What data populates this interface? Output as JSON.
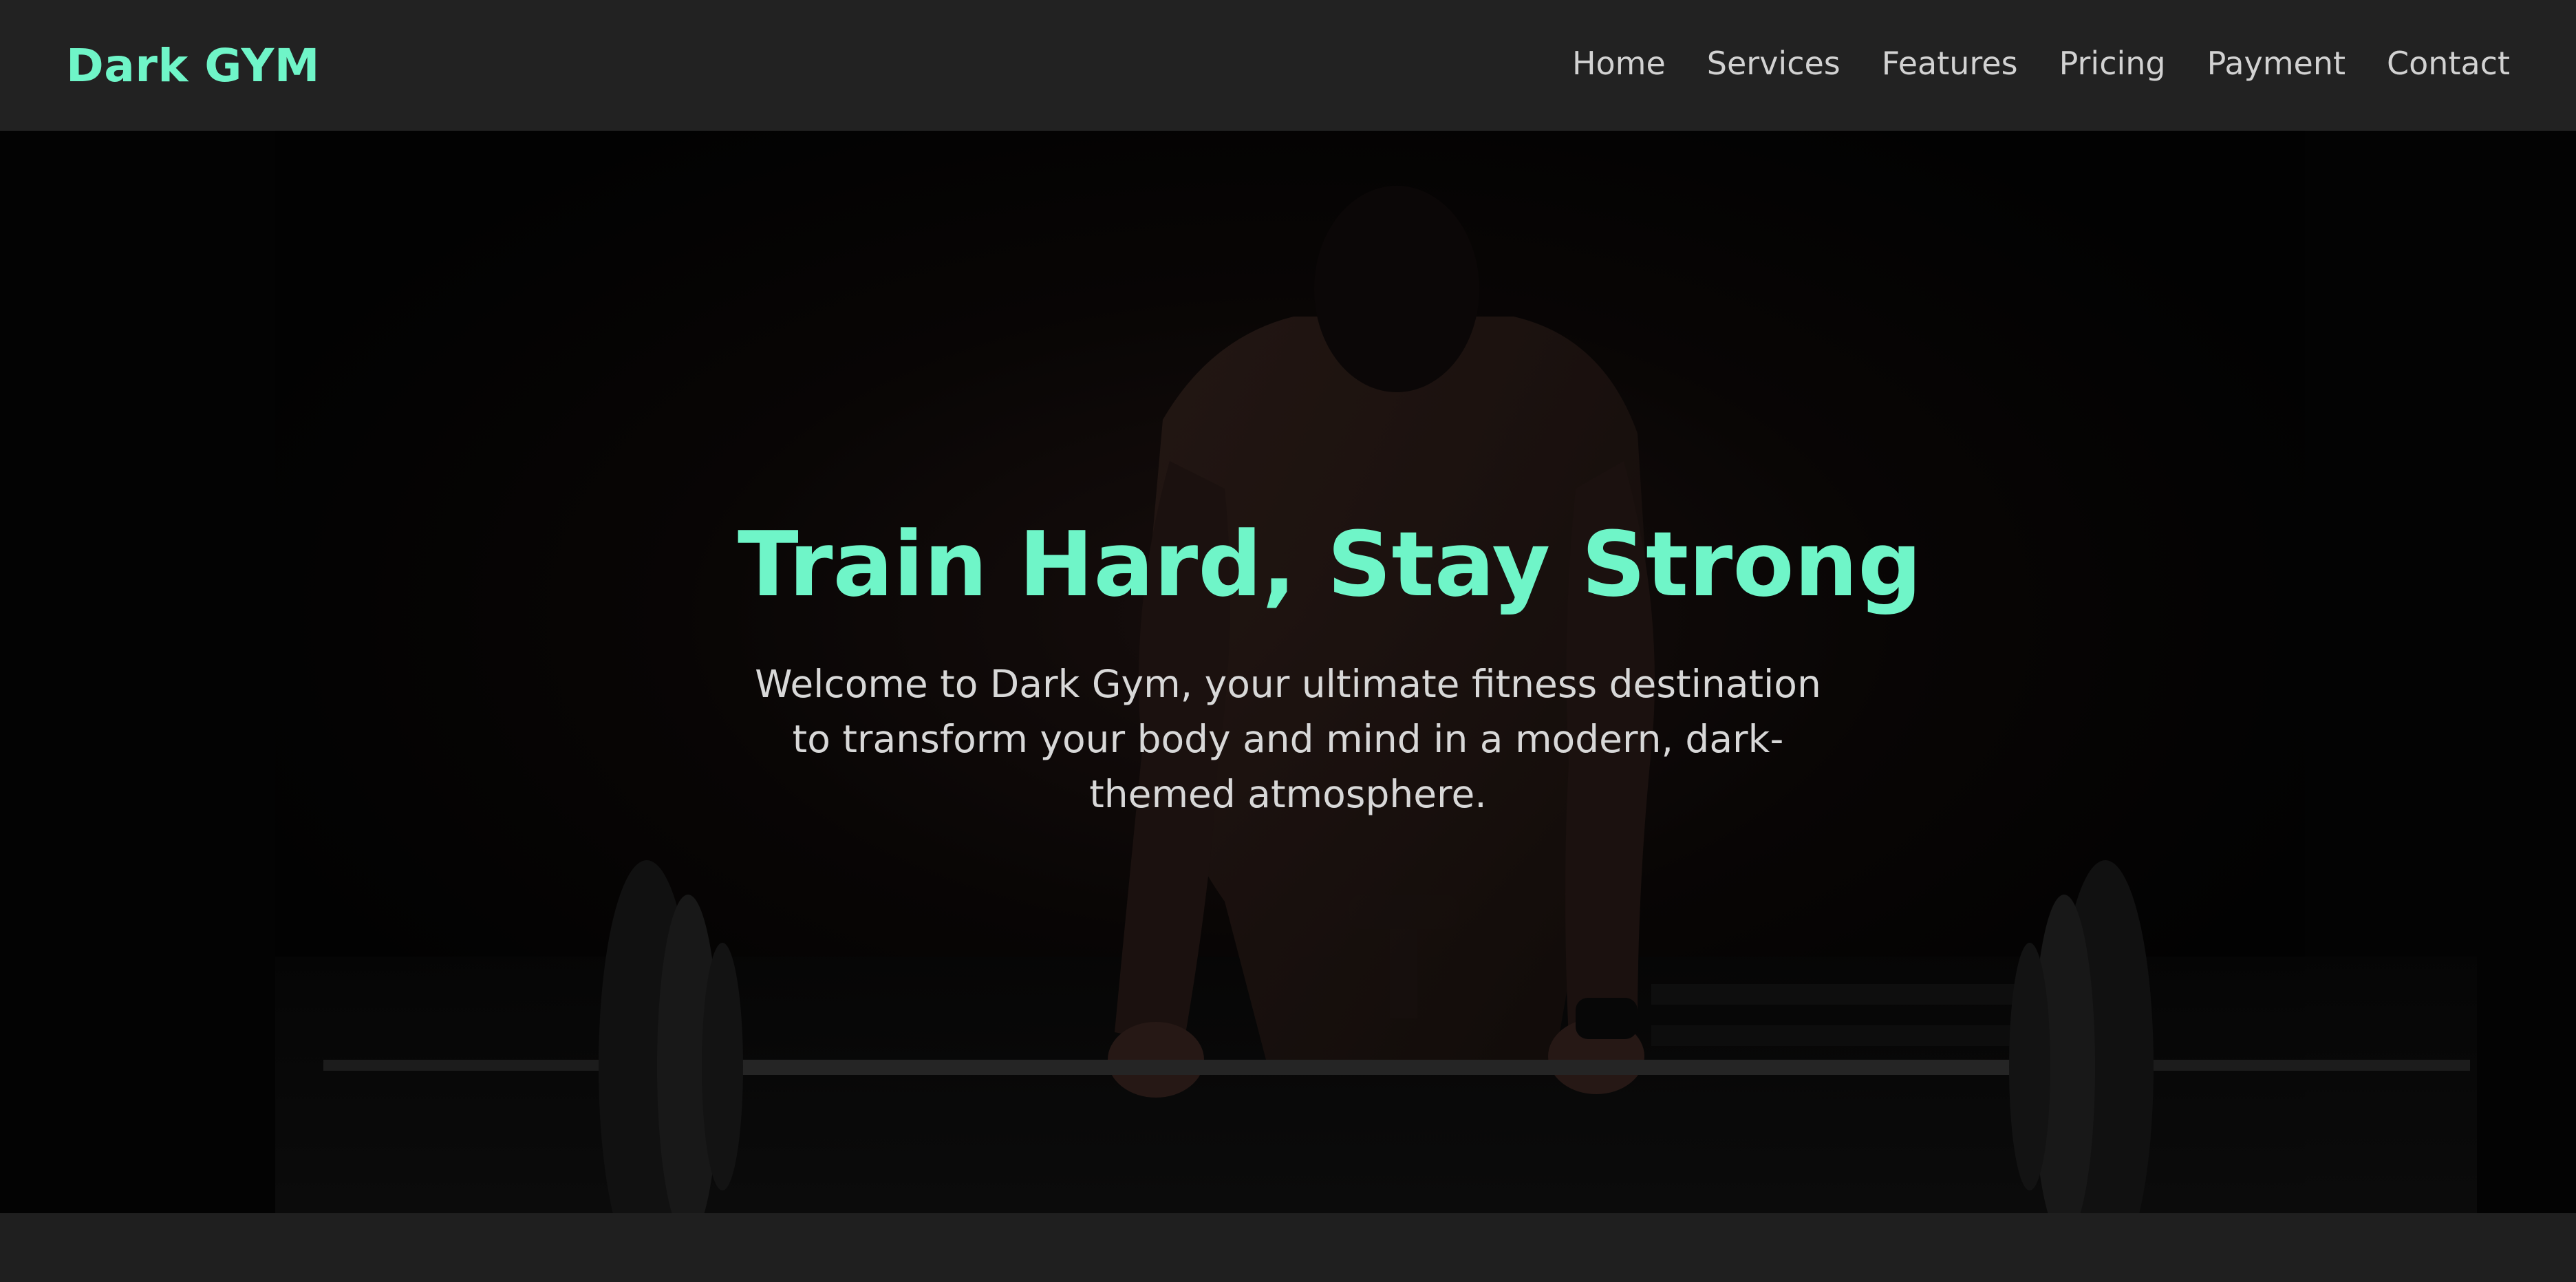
{
  "navbar": {
    "logo": "Dark GYM",
    "links": [
      {
        "label": "Home"
      },
      {
        "label": "Services"
      },
      {
        "label": "Features"
      },
      {
        "label": "Pricing"
      },
      {
        "label": "Payment"
      },
      {
        "label": "Contact"
      }
    ]
  },
  "hero": {
    "title": "Train Hard, Stay Strong",
    "description": "Welcome to Dark Gym, your ultimate fitness destination to transform your body and mind in a modern, dark-themed atmosphere."
  },
  "colors": {
    "accent": "#6ff5c8",
    "nav_background": "#222222",
    "hero_background": "#050505",
    "text_light": "#d8d8d8"
  }
}
